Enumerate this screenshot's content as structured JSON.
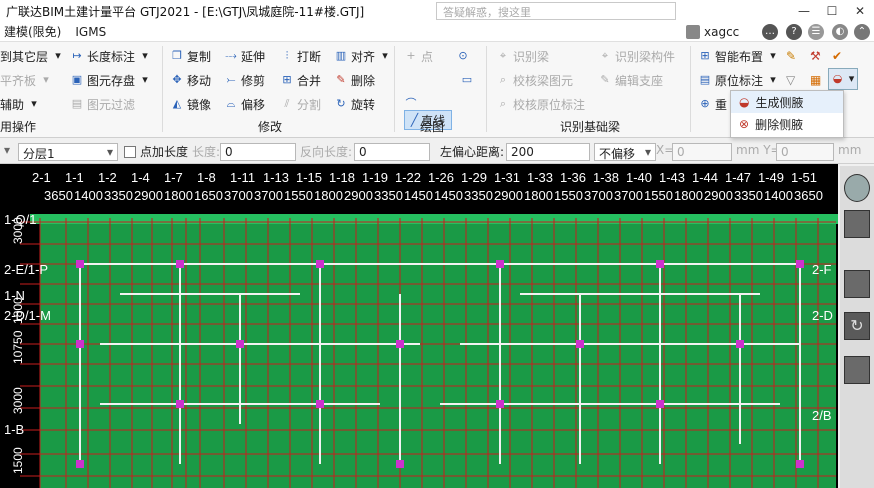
{
  "window": {
    "title": "广联达BIM土建计量平台 GTJ2021 - [E:\\GTJ\\凤城庭院-11#楼.GTJ]",
    "search_placeholder": "答疑解惑，搜这里",
    "minimize": "—",
    "maximize": "☐",
    "close": "✕"
  },
  "menubar": {
    "items": [
      "建模(限免)",
      "IGMS"
    ],
    "username": "xagcc"
  },
  "ribbon": {
    "left_cut": {
      "item1": "到其它层",
      "item2": "平齐板",
      "item3": "辅助",
      "label": "用操作"
    },
    "annotate": {
      "length_label": "长度标注",
      "save_element": "图元存盘",
      "filter": "图元过滤"
    },
    "modify": {
      "copy": "复制",
      "extend": "延伸",
      "break": "打断",
      "align": "对齐",
      "move": "移动",
      "trim": "修剪",
      "merge": "合并",
      "delete": "删除",
      "mirror": "镜像",
      "offset": "偏移",
      "split": "分割",
      "rotate": "旋转",
      "label": "修改"
    },
    "draw": {
      "point": "点",
      "line": "直线",
      "label": "绘图"
    },
    "identify": {
      "identify_beam": "识别梁",
      "identify_beam_rebar": "识别梁构件",
      "check_beam": "校核梁图元",
      "edit_support": "编辑支座",
      "check_beam_label": "校核原位标注",
      "label": "识别基础梁"
    },
    "smart": {
      "smart_layout": "智能布置",
      "in_situ_label": "原位标注",
      "redo_short": "重"
    }
  },
  "popup": {
    "items": [
      "生成侧腋",
      "删除侧腋"
    ]
  },
  "propbar": {
    "floor": "分层1",
    "add_length": "点加长度",
    "length_label": "长度:",
    "length_value": "0",
    "reverse_label": "反向长度:",
    "reverse_value": "0",
    "offset_label": "左偏心距离:",
    "offset_value": "200",
    "no_offset": "不偏移",
    "x_label": "X=",
    "x_value": "0",
    "y_label": "mm Y=",
    "y_value": "0",
    "unit": "mm"
  },
  "canvas": {
    "axis_top_labels": [
      "2-1",
      "1-1",
      "1-2",
      "1-4",
      "1-7",
      "1-8",
      "1-11",
      "1-13",
      "1-15",
      "1-18",
      "1-19",
      "1-22",
      "1-26",
      "1-29",
      "1-31",
      "1-33",
      "1-36",
      "1-38",
      "1-40",
      "1-43",
      "1-44",
      "1-47",
      "1-49",
      "1-51"
    ],
    "axis_top_dims": [
      "3650",
      "1400",
      "3350",
      "2900",
      "1800",
      "1650",
      "3700",
      "3700",
      "1550",
      "1800",
      "2900",
      "3350",
      "1450",
      "1450",
      "3350",
      "2900",
      "1800",
      "1550",
      "3700",
      "3700",
      "1550",
      "1800",
      "2900",
      "3350",
      "1400",
      "3650"
    ],
    "axis_left_labels": [
      "1-Q/1",
      "2-E/1-P",
      "2-D/1-M",
      "1-N",
      "1-B"
    ],
    "axis_right_labels": [
      "2-F",
      "2-D",
      "2/B"
    ],
    "left_dims": [
      "3000",
      "1800",
      "10750",
      "3000",
      "1500"
    ],
    "colors": {
      "background": "#000000",
      "slab": "#1a9a46",
      "grid": "#c81e1e",
      "wall": "#f2f2f2",
      "column": "#cc33cc",
      "axis_text": "#ffffff"
    }
  }
}
